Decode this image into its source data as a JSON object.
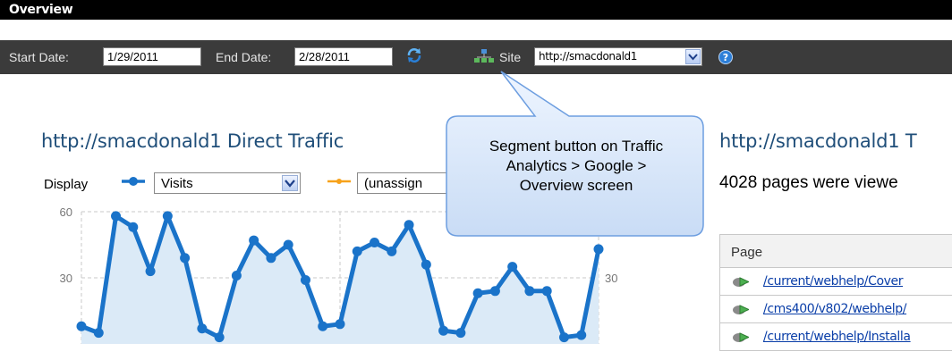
{
  "window": {
    "title": "Overview"
  },
  "toolbar": {
    "start_label": "Start Date:",
    "start_value": "1/29/2011",
    "end_label": "End Date:",
    "end_value": "2/28/2011",
    "refresh_icon": "refresh-icon",
    "site_label": "Site",
    "site_value": "http://smacdonald1",
    "help_icon": "help-icon"
  },
  "left_panel": {
    "title": "http://smacdonald1 Direct Traffic",
    "display_label": "Display",
    "metric1": "Visits",
    "metric2": "(unassign"
  },
  "right_panel": {
    "title": "http://smacdonald1 T",
    "summary": "4028 pages were viewe",
    "table": {
      "header": "Page",
      "rows": [
        "/current/webhelp/Cover",
        "/cms400/v802/webhelp/",
        "/current/webhelp/Installa"
      ]
    }
  },
  "callout": {
    "lines": [
      "Segment button on Traffic",
      "Analytics > Google >",
      "Overview screen"
    ]
  },
  "colors": {
    "accent": "#1a73c9",
    "fill": "#dbeaf7",
    "secondary": "#f7a21b"
  },
  "chart_data": {
    "type": "area",
    "series": [
      {
        "name": "Visits",
        "values": [
          8,
          5,
          58,
          53,
          33,
          58,
          39,
          7,
          3,
          31,
          47,
          39,
          45,
          29,
          8,
          9,
          42,
          46,
          42,
          54,
          36,
          6,
          5,
          23,
          24,
          35,
          24,
          24,
          3,
          4,
          43
        ]
      }
    ],
    "ylim": [
      0,
      60
    ],
    "yticks_left": [
      "60",
      "30"
    ],
    "yticks_right": [
      "30"
    ],
    "grid": true
  }
}
